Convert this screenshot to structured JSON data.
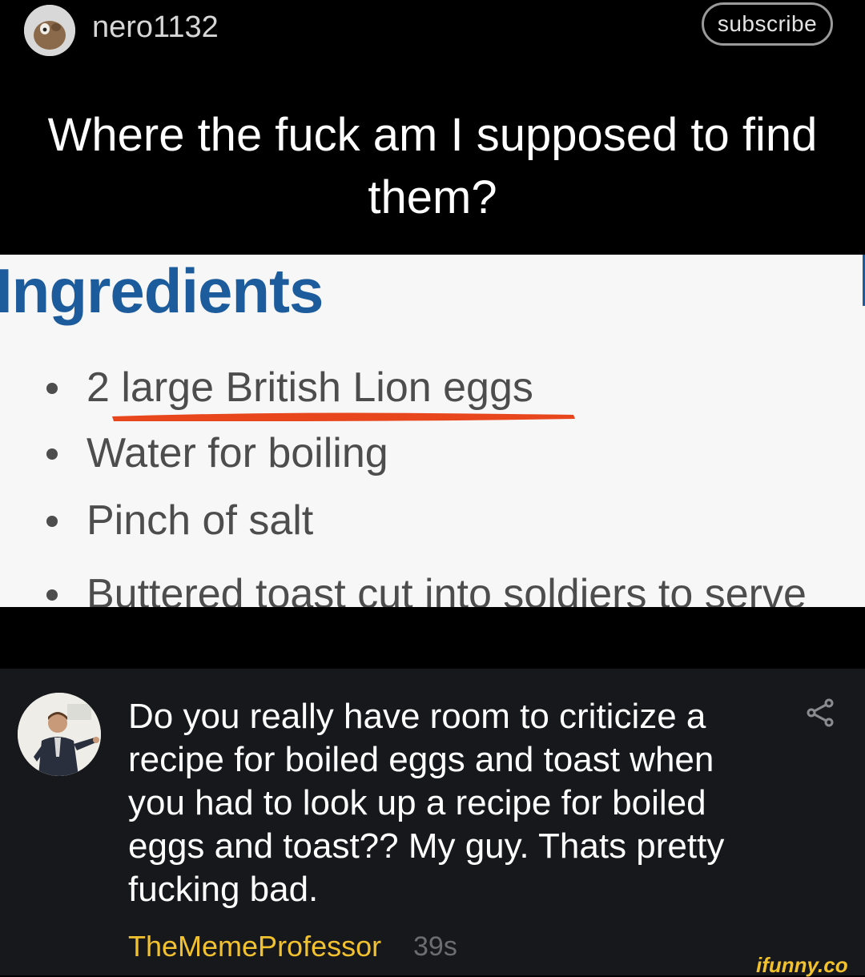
{
  "post": {
    "username": "nero1132",
    "subscribe_label": "subscribe",
    "caption": "Where the fuck am I supposed to find them?"
  },
  "recipe": {
    "title": "Ingredients",
    "items": [
      "2 large British Lion eggs",
      "Water for boiling",
      "Pinch of salt",
      "Buttered toast cut into soldiers to serve"
    ],
    "highlight_color": "#e8461c"
  },
  "comment": {
    "text": "Do you really have room to criticize a recipe for boiled eggs and toast when you had to look up a recipe for boiled eggs and toast?? My guy. Thats pretty fucking bad.",
    "author": "TheMemeProfessor",
    "age": "39s"
  },
  "watermark": "ifunny.co",
  "colors": {
    "author_name": "#f2c12e",
    "recipe_title": "#1c5b9c",
    "comment_bg": "#17181c"
  }
}
